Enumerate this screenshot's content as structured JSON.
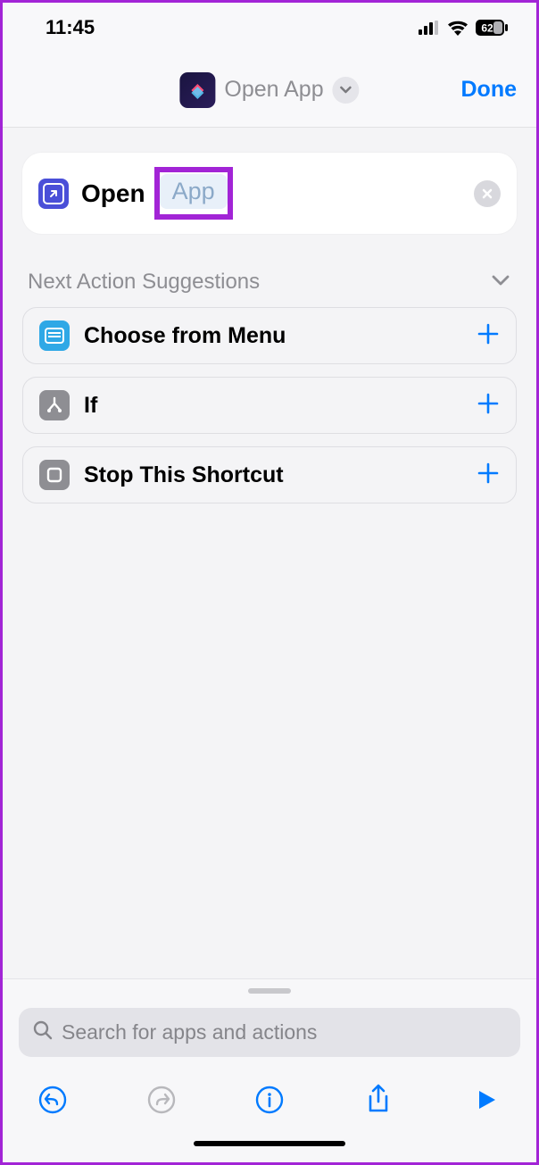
{
  "statusbar": {
    "time": "11:45",
    "battery": "62"
  },
  "header": {
    "title": "Open App",
    "done_label": "Done"
  },
  "action": {
    "open_label": "Open",
    "param_label": "App"
  },
  "suggestions": {
    "title": "Next Action Suggestions",
    "items": [
      {
        "label": "Choose from Menu"
      },
      {
        "label": "If"
      },
      {
        "label": "Stop This Shortcut"
      }
    ]
  },
  "search": {
    "placeholder": "Search for apps and actions"
  },
  "colors": {
    "accent": "#007aff",
    "highlight_border": "#a224d6"
  }
}
